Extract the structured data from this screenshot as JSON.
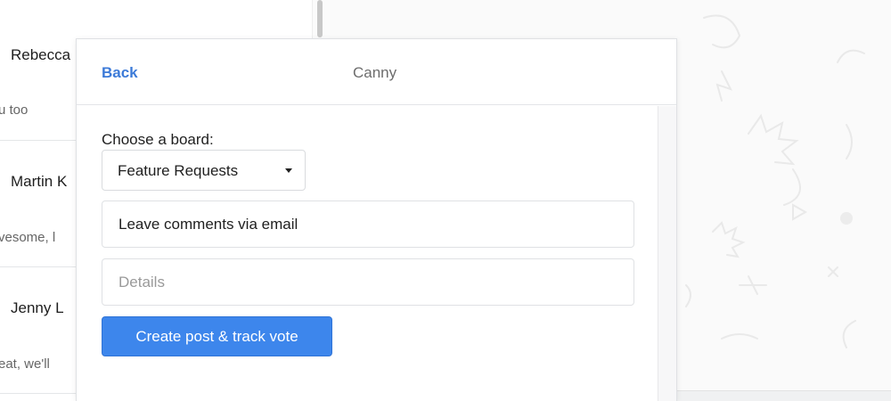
{
  "conversations": [
    {
      "name": "Rebecca",
      "snippet": "u too"
    },
    {
      "name": "Martin K",
      "snippet": "vesome, l"
    },
    {
      "name": "Jenny L",
      "snippet": "eat, we'll"
    }
  ],
  "modal": {
    "back_label": "Back",
    "title": "Canny",
    "board_label": "Choose a board:",
    "board_selected": "Feature Requests",
    "title_value": "Leave comments via email",
    "details_placeholder": "Details",
    "submit_label": "Create post & track vote"
  },
  "colors": {
    "accent": "#3d86ec",
    "link": "#3c7ad8"
  },
  "icons": {
    "dropdown": "caret-down-icon"
  }
}
